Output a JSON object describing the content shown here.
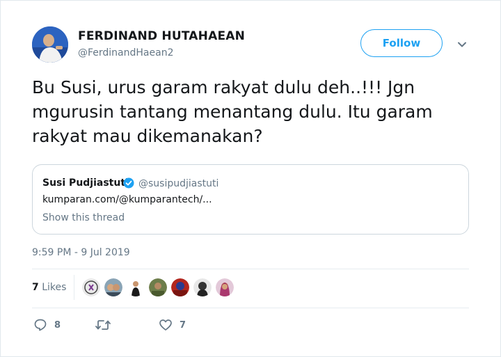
{
  "author": {
    "name": "FERDINAND HUTAHAEAN",
    "handle": "@FerdinandHaean2",
    "avatar_icon": "profile-photo"
  },
  "header": {
    "follow_label": "Follow",
    "menu_icon": "chevron-down-icon"
  },
  "tweet": {
    "text": "Bu Susi, urus garam rakyat dulu deh..!!! Jgn mgurusin tantang menantang dulu. Itu garam rakyat mau dikemanakan?",
    "timestamp": "9:59 PM - 9 Jul 2019"
  },
  "quoted": {
    "name": "Susi Pudjiastuti",
    "handle": "@susipudjiastuti",
    "link": "kumparan.com/@kumparantech/...",
    "show_thread": "Show this thread",
    "verified_icon": "verified-badge-icon"
  },
  "likes": {
    "count": "7",
    "label": "Likes"
  },
  "actions": {
    "reply_count": "8",
    "like_count": "7"
  },
  "colors": {
    "accent": "#1da1f2",
    "text": "#14171a",
    "muted": "#657786",
    "border": "#ccd6dd"
  }
}
